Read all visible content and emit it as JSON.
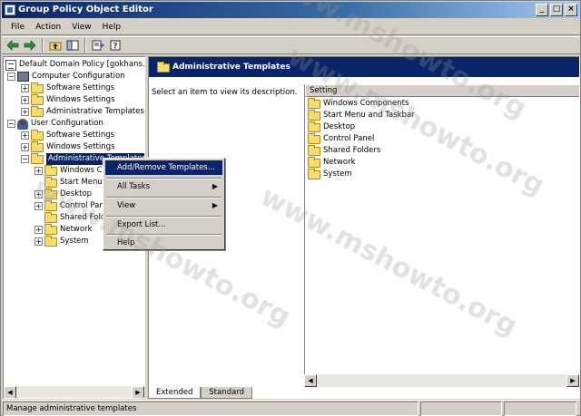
{
  "window": {
    "title": "Group Policy Object Editor"
  },
  "menu": [
    {
      "label": "File"
    },
    {
      "label": "Action"
    },
    {
      "label": "View"
    },
    {
      "label": "Help"
    }
  ],
  "toolbar": {
    "icons": [
      "back-arrow-icon",
      "forward-arrow-icon",
      "up-folder-icon",
      "show-hide-tree-icon",
      "export-list-icon",
      "help-icon"
    ]
  },
  "tree": {
    "root": "Default Domain Policy [gokhans.gokhan",
    "computer_config": "Computer Configuration",
    "user_config": "User Configuration",
    "computer_children": [
      "Software Settings",
      "Windows Settings",
      "Administrative Templates"
    ],
    "user_children": [
      "Software Settings",
      "Windows Settings",
      "Administrative Templates"
    ],
    "admin_children": [
      "Windows Co",
      "Start Menu",
      "Desktop",
      "Control Pan",
      "Shared Fold",
      "Network",
      "System"
    ]
  },
  "right": {
    "header": "Administrative Templates",
    "description": "Select an item to view its description.",
    "column_header": "Setting",
    "items": [
      "Windows Components",
      "Start Menu and Taskbar",
      "Desktop",
      "Control Panel",
      "Shared Folders",
      "Network",
      "System"
    ]
  },
  "context_menu": {
    "items": [
      "Add/Remove Templates...",
      "All Tasks",
      "View",
      "Export List...",
      "Help"
    ]
  },
  "tabs": [
    "Extended",
    "Standard"
  ],
  "status": {
    "text": "Manage administrative templates"
  },
  "watermark": "www.mshowto.org"
}
